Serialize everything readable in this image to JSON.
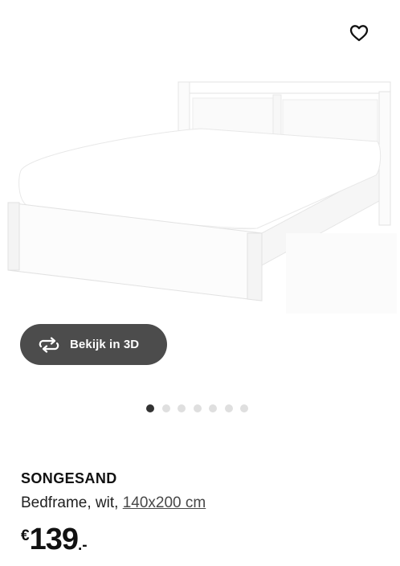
{
  "gallery": {
    "favorite_icon": "heart-outline-icon",
    "view_3d_icon": "rotate-3d-icon",
    "view_3d_label": "Bekijk in 3D",
    "image_count": 7,
    "active_index": 0
  },
  "product": {
    "name": "SONGESAND",
    "description": "Bedframe, wit, ",
    "size": "140x200 cm",
    "price": {
      "currency": "€",
      "amount": "139",
      "cents": ".-"
    }
  },
  "colors": {
    "button_bg": "#4c4c4c",
    "dot_active": "#333333",
    "dot_inactive": "#dfdfdf"
  }
}
